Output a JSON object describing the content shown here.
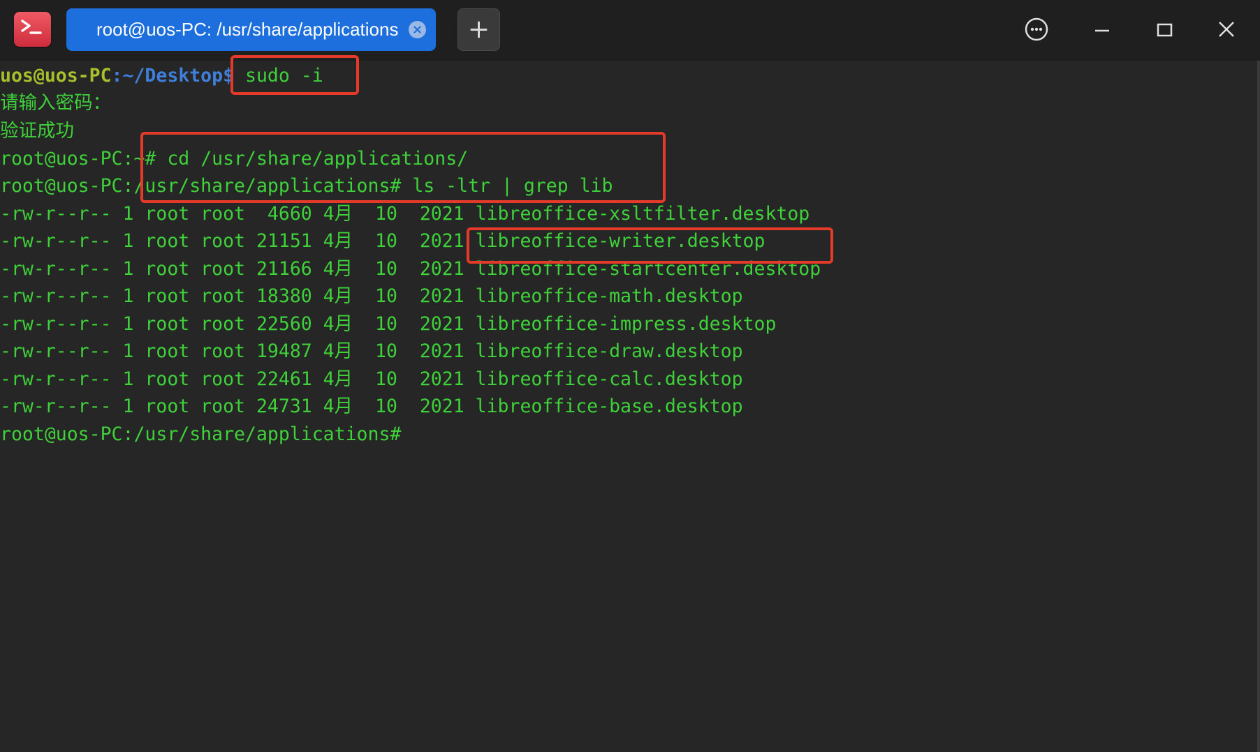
{
  "window": {
    "tab_title": "root@uos-PC: /usr/share/applications",
    "icons": {
      "app": "terminal-icon",
      "tab_close": "close-circle-icon",
      "new_tab": "plus-icon",
      "menu": "more-options-icon",
      "minimize": "minimize-icon",
      "maximize": "maximize-icon",
      "close": "close-icon"
    },
    "accent_color": "#1e6fde"
  },
  "terminal": {
    "line1": {
      "user": "uos@uos-PC",
      "path": ":~/Desktop$",
      "command": " sudo -i"
    },
    "line2": "请输入密码：",
    "line3": "验证成功",
    "line4": {
      "prompt": "root@uos-PC:~#",
      "command": " cd /usr/share/applications/"
    },
    "line5": {
      "prompt": "root@uos-PC:/usr/share/applications#",
      "command": " ls -ltr | grep lib"
    },
    "listing": [
      "-rw-r--r-- 1 root root  4660 4月  10  2021 libreoffice-xsltfilter.desktop",
      "-rw-r--r-- 1 root root 21151 4月  10  2021 libreoffice-writer.desktop",
      "-rw-r--r-- 1 root root 21166 4月  10  2021 libreoffice-startcenter.desktop",
      "-rw-r--r-- 1 root root 18380 4月  10  2021 libreoffice-math.desktop",
      "-rw-r--r-- 1 root root 22560 4月  10  2021 libreoffice-impress.desktop",
      "-rw-r--r-- 1 root root 19487 4月  10  2021 libreoffice-draw.desktop",
      "-rw-r--r-- 1 root root 22461 4月  10  2021 libreoffice-calc.desktop",
      "-rw-r--r-- 1 root root 24731 4月  10  2021 libreoffice-base.desktop"
    ],
    "final_prompt": "root@uos-PC:/usr/share/applications#",
    "text_color": "#3fd13a",
    "highlight_color": "#e43a2a"
  }
}
